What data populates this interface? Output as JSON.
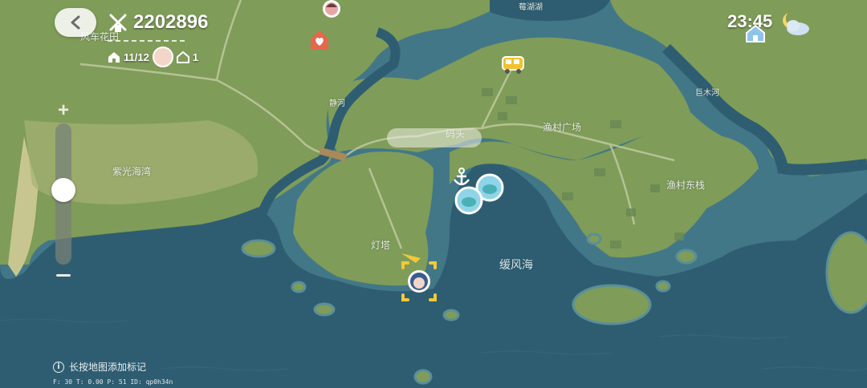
{
  "header": {
    "coins": "2202896",
    "home_fraction": "11/12",
    "house_count": "1",
    "area_name": "风车花田",
    "time": "23:45"
  },
  "map_labels": {
    "zi_guang_bay": "紫光海湾",
    "lighthouse": "灯塔",
    "huan_feng_sea": "缓风海",
    "dock": "码头",
    "fishing_square": "渔村广场",
    "fishing_east": "渔村东栈",
    "jing_river": "静河",
    "ju_mu_river": "巨木河",
    "top_lake": "莓湖湖"
  },
  "footer": {
    "hint": "长按地图添加标记",
    "debug": "F: 30    T: 0.00    P: 51    ID: qp0h34n"
  },
  "zoom": {
    "level": 0.15
  },
  "colors": {
    "sea": "#2f5f73",
    "land": "#7e9b58",
    "accent": "#e4684a"
  }
}
